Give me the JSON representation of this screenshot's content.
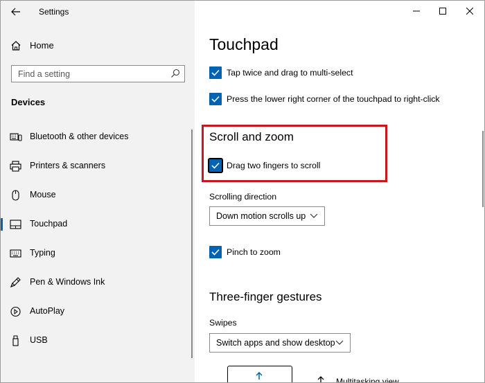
{
  "window": {
    "app_title": "Settings"
  },
  "sidebar": {
    "home_label": "Home",
    "search_placeholder": "Find a setting",
    "section_title": "Devices",
    "items": [
      {
        "label": "Bluetooth & other devices",
        "icon": "bluetooth-devices-icon"
      },
      {
        "label": "Printers & scanners",
        "icon": "printer-icon"
      },
      {
        "label": "Mouse",
        "icon": "mouse-icon"
      },
      {
        "label": "Touchpad",
        "icon": "touchpad-icon",
        "selected": true
      },
      {
        "label": "Typing",
        "icon": "keyboard-icon"
      },
      {
        "label": "Pen & Windows Ink",
        "icon": "pen-icon"
      },
      {
        "label": "AutoPlay",
        "icon": "autoplay-icon"
      },
      {
        "label": "USB",
        "icon": "usb-icon"
      }
    ]
  },
  "main": {
    "title": "Touchpad",
    "tap_drag_label": "Tap twice and drag to multi-select",
    "right_click_label": "Press the lower right corner of the touchpad to right-click",
    "scroll_zoom_heading": "Scroll and zoom",
    "drag_two_fingers_label": "Drag two fingers to scroll",
    "scrolling_direction_label": "Scrolling direction",
    "scrolling_direction_value": "Down motion scrolls up",
    "pinch_zoom_label": "Pinch to zoom",
    "three_finger_heading": "Three-finger gestures",
    "swipes_label": "Swipes",
    "swipes_value": "Switch apps and show desktop",
    "multitasking_label": "Multitasking view"
  },
  "colors": {
    "accent": "#0063b1",
    "highlight": "#c4191f",
    "sidebar_bg": "#f2f2f2"
  }
}
